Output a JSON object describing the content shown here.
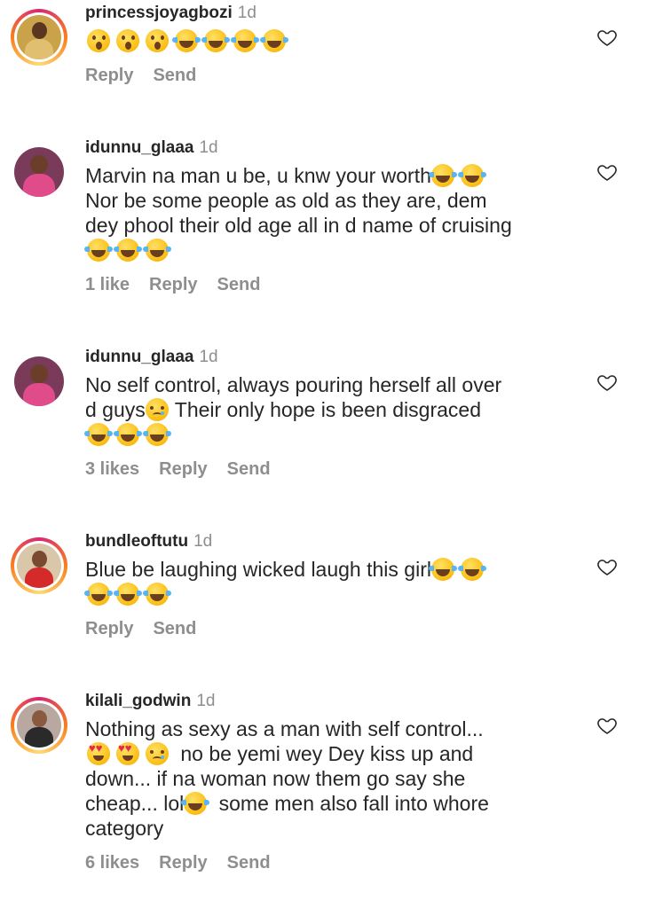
{
  "comments": [
    {
      "username": "princessjoyagbozi",
      "time": "1d",
      "lines": [
        {
          "segments": [
            {
              "emoji": "wow"
            },
            {
              "emoji": "wow"
            },
            {
              "emoji": "wow"
            },
            {
              "emoji": "laugh"
            },
            {
              "emoji": "laugh"
            },
            {
              "emoji": "laugh"
            },
            {
              "emoji": "laugh"
            }
          ]
        }
      ],
      "likes": "",
      "reply_label": "Reply",
      "send_label": "Send",
      "avatar": {
        "ring": true,
        "bg": "#c9a24a",
        "skin": "#5a3520",
        "cloth": "#e0c070"
      }
    },
    {
      "username": "idunnu_glaaa",
      "time": "1d",
      "lines": [
        {
          "segments": [
            {
              "text": "Marvin na man u be, u knw your worth"
            },
            {
              "emoji": "laugh"
            },
            {
              "emoji": "laugh"
            }
          ]
        },
        {
          "segments": [
            {
              "text": "Nor be some people as old as they are, dem"
            }
          ]
        },
        {
          "segments": [
            {
              "text": "dey phool their old age all in d name of cruising"
            }
          ]
        },
        {
          "segments": [
            {
              "emoji": "laugh"
            },
            {
              "emoji": "laugh"
            },
            {
              "emoji": "laugh"
            }
          ]
        }
      ],
      "likes": "1 like",
      "reply_label": "Reply",
      "send_label": "Send",
      "avatar": {
        "ring": false,
        "bg": "#7a3a5a",
        "skin": "#6b3e2a",
        "cloth": "#e04c8a"
      }
    },
    {
      "username": "idunnu_glaaa",
      "time": "1d",
      "lines": [
        {
          "segments": [
            {
              "text": "No self control, always pouring herself all over"
            }
          ]
        },
        {
          "segments": [
            {
              "text": "d guys"
            },
            {
              "emoji": "cry"
            },
            {
              "text": "Their only hope is been disgraced"
            }
          ]
        },
        {
          "segments": [
            {
              "emoji": "laugh"
            },
            {
              "emoji": "laugh"
            },
            {
              "emoji": "laugh"
            }
          ]
        }
      ],
      "likes": "3 likes",
      "reply_label": "Reply",
      "send_label": "Send",
      "avatar": {
        "ring": false,
        "bg": "#7a3a5a",
        "skin": "#6b3e2a",
        "cloth": "#e04c8a"
      }
    },
    {
      "username": "bundleoftutu",
      "time": "1d",
      "lines": [
        {
          "segments": [
            {
              "text": "Blue be laughing wicked laugh this girl"
            },
            {
              "emoji": "laugh"
            },
            {
              "emoji": "laugh"
            }
          ]
        },
        {
          "segments": [
            {
              "emoji": "laugh"
            },
            {
              "emoji": "laugh"
            },
            {
              "emoji": "laugh"
            }
          ]
        }
      ],
      "likes": "",
      "reply_label": "Reply",
      "send_label": "Send",
      "avatar": {
        "ring": true,
        "bg": "#d8c7a8",
        "skin": "#7a4a30",
        "cloth": "#d42a2a"
      }
    },
    {
      "username": "kilali_godwin",
      "time": "1d",
      "lines": [
        {
          "segments": [
            {
              "text": "Nothing as sexy as a man with self control..."
            }
          ]
        },
        {
          "segments": [
            {
              "emoji": "love"
            },
            {
              "emoji": "love"
            },
            {
              "emoji": "cry"
            },
            {
              "text": " no be yemi wey Dey kiss up and"
            }
          ]
        },
        {
          "segments": [
            {
              "text": "down... if na woman now them go say she"
            }
          ]
        },
        {
          "segments": [
            {
              "text": "cheap... lol"
            },
            {
              "emoji": "laugh"
            },
            {
              "text": " some men also fall into whore"
            }
          ]
        },
        {
          "segments": [
            {
              "text": "category"
            }
          ]
        }
      ],
      "likes": "6 likes",
      "reply_label": "Reply",
      "send_label": "Send",
      "avatar": {
        "ring": true,
        "bg": "#b8a8a0",
        "skin": "#8a5a40",
        "cloth": "#2a2a2a"
      }
    }
  ],
  "icons": {
    "heart": "heart-outline-icon",
    "emoji_laugh": "tears-of-joy-emoji",
    "emoji_wow": "surprised-face-emoji",
    "emoji_love": "heart-eyes-emoji",
    "emoji_cry": "crying-face-emoji"
  },
  "colors": {
    "text": "#262626",
    "muted": "#8e8e8e",
    "ring_start": "#d62976",
    "ring_end": "#feda75"
  }
}
